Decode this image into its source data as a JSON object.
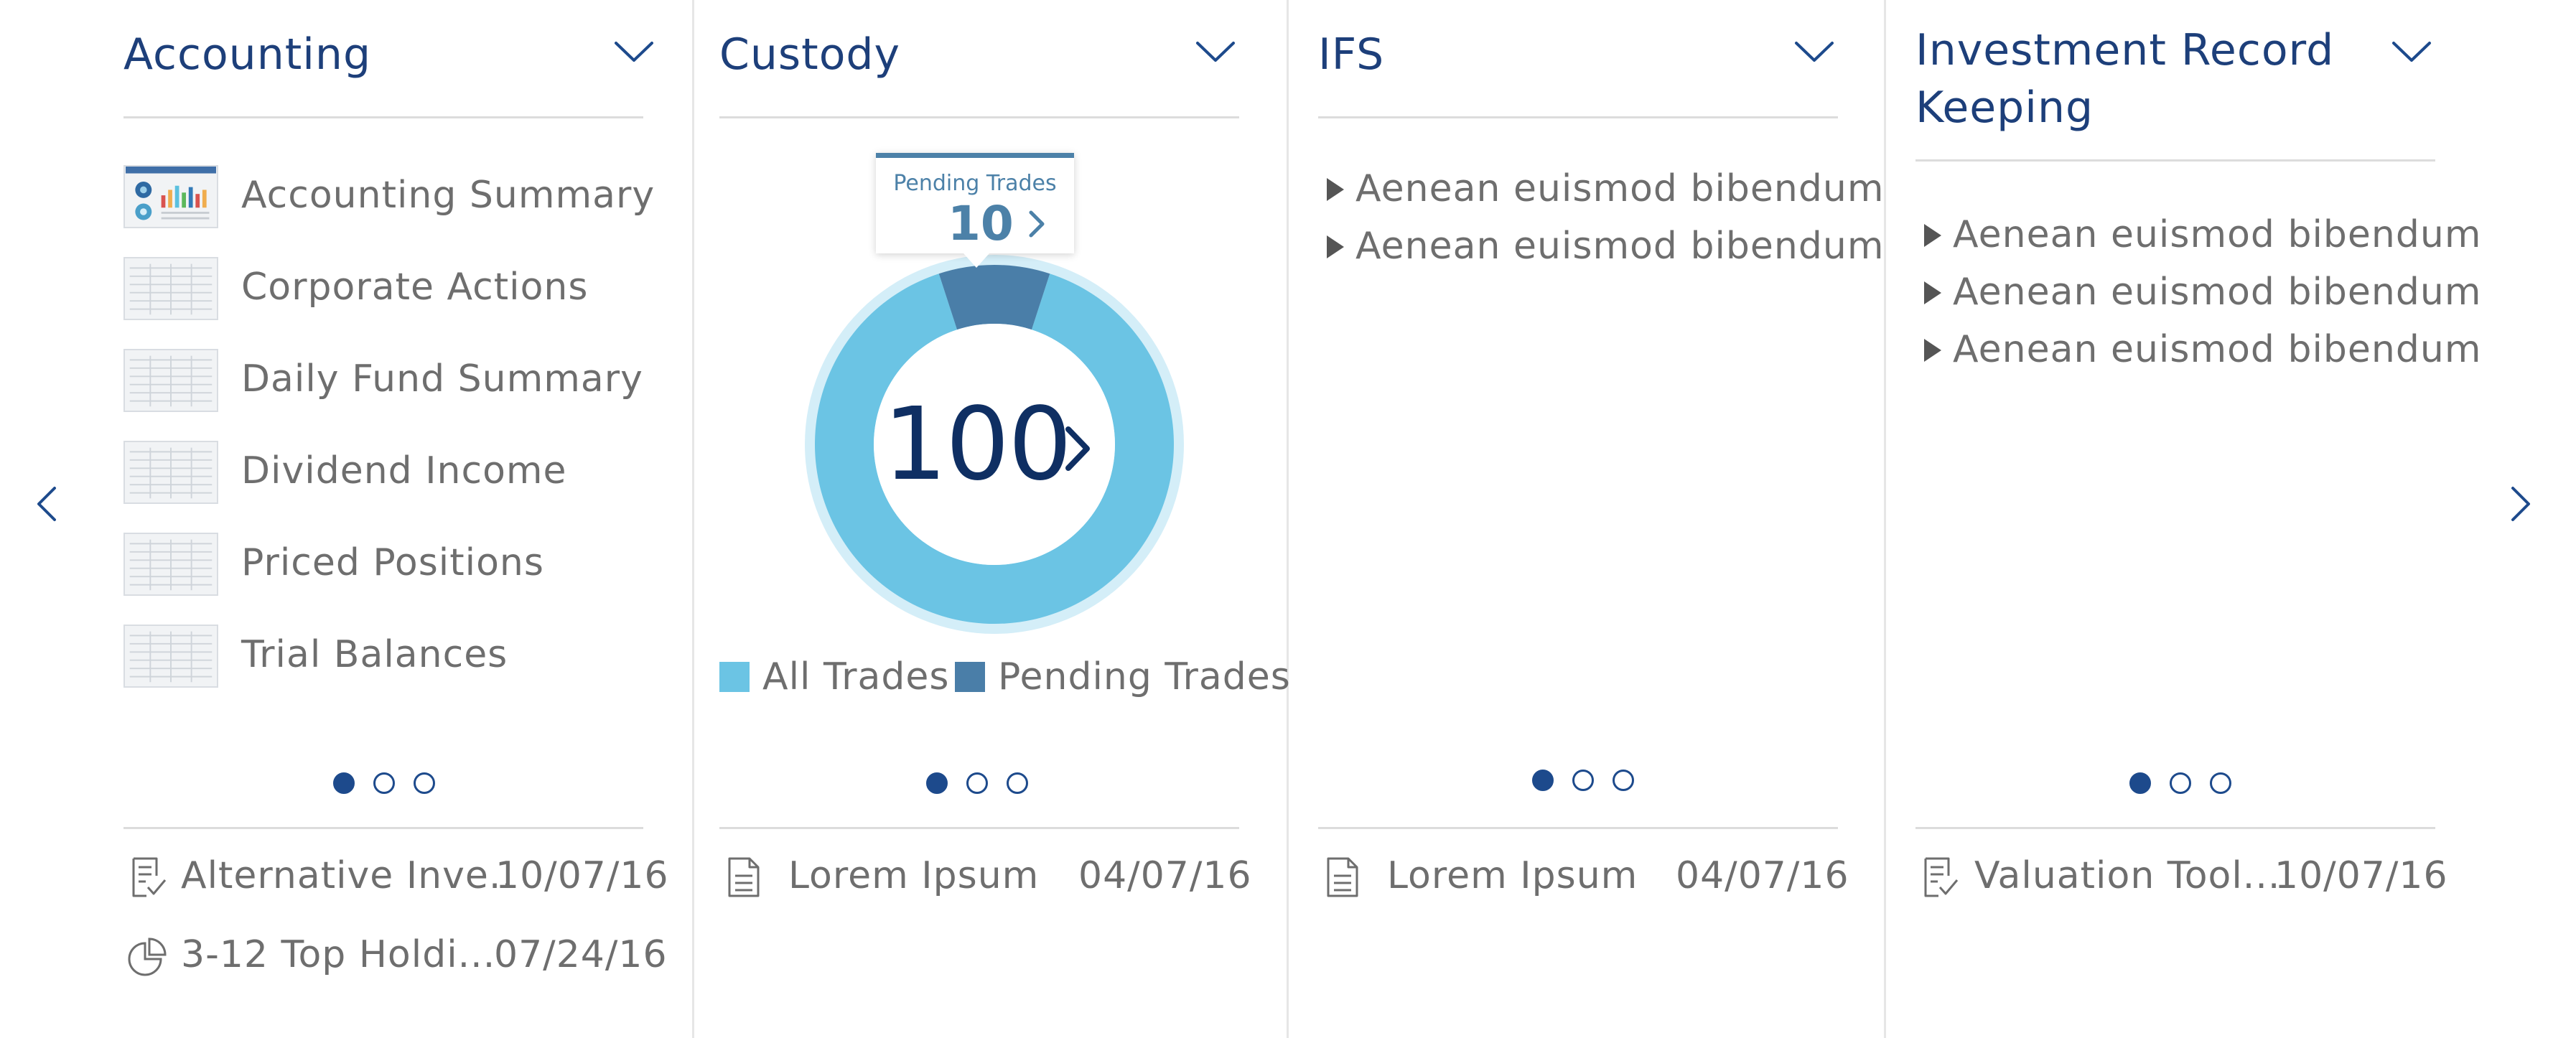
{
  "nav": {
    "prev_icon": "chevron-left-icon",
    "next_icon": "chevron-right-icon"
  },
  "colors": {
    "title": "#1d3f7a",
    "all_trades": "#6bc4e4",
    "pending_trades": "#4a7ea8",
    "donut_halo": "#d4eef8",
    "dot": "#1d4a8c"
  },
  "accounting": {
    "title": "Accounting",
    "reports": [
      {
        "label": "Accounting Summary",
        "thumb": "dashboard-thumbnail"
      },
      {
        "label": "Corporate Actions",
        "thumb": "table-thumbnail"
      },
      {
        "label": "Daily Fund Summary",
        "thumb": "table-thumbnail"
      },
      {
        "label": "Dividend Income",
        "thumb": "table-thumbnail"
      },
      {
        "label": "Priced Positions",
        "thumb": "table-thumbnail"
      },
      {
        "label": "Trial Balances",
        "thumb": "table-thumbnail"
      }
    ],
    "pager": {
      "pages": 3,
      "active": 1
    },
    "documents": [
      {
        "name": "Alternative Inve..",
        "date": "10/07/16",
        "icon": "checklist-doc-icon"
      },
      {
        "name": "3-12 Top Holdi...",
        "date": "07/24/16",
        "icon": "pie-chart-icon"
      }
    ]
  },
  "custody": {
    "title": "Custody",
    "total": "100",
    "tooltip": {
      "label": "Pending Trades",
      "value": "10"
    },
    "legend": [
      {
        "label": "All Trades"
      },
      {
        "label": "Pending Trades"
      }
    ],
    "pager": {
      "pages": 3,
      "active": 1
    },
    "documents": [
      {
        "name": "Lorem Ipsum",
        "date": "04/07/16",
        "icon": "document-icon"
      }
    ]
  },
  "chart_data": {
    "type": "pie",
    "categories": [
      "All Trades",
      "Pending Trades"
    ],
    "values": [
      90,
      10
    ],
    "total": 100,
    "legend": "bottom"
  },
  "ifs": {
    "title": "IFS",
    "items": [
      "Aenean euismod bibendum",
      "Aenean euismod bibendum"
    ],
    "pager": {
      "pages": 3,
      "active": 1
    },
    "documents": [
      {
        "name": "Lorem Ipsum",
        "date": "04/07/16",
        "icon": "document-icon"
      }
    ]
  },
  "irk": {
    "title_line1": "Investment Record",
    "title_line2": "Keeping",
    "items": [
      "Aenean euismod bibendum",
      "Aenean euismod bibendum",
      "Aenean euismod bibendum"
    ],
    "pager": {
      "pages": 3,
      "active": 1
    },
    "documents": [
      {
        "name": "Valuation Tool...",
        "date": "10/07/16",
        "icon": "checklist-doc-icon"
      }
    ]
  }
}
